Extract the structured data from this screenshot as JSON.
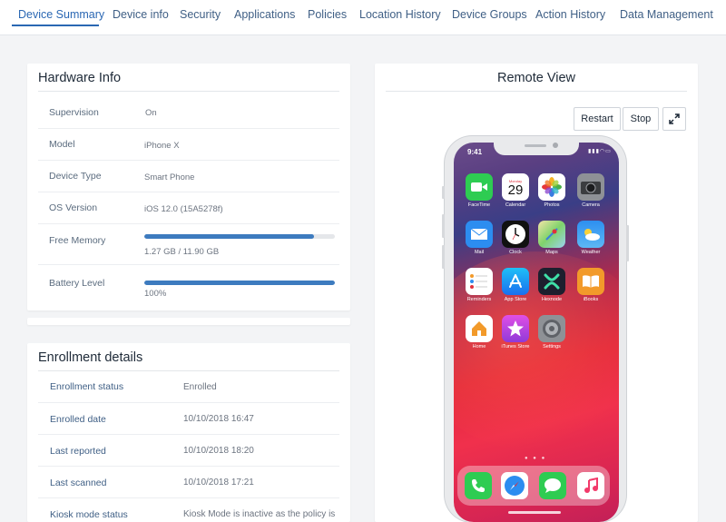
{
  "tabs": [
    {
      "label": "Device Summary",
      "active": true
    },
    {
      "label": "Device info"
    },
    {
      "label": "Security"
    },
    {
      "label": "Applications"
    },
    {
      "label": "Policies"
    },
    {
      "label": "Location History"
    },
    {
      "label": "Device Groups"
    },
    {
      "label": "Action History"
    },
    {
      "label": "Data Management"
    }
  ],
  "hardware": {
    "title": "Hardware Info",
    "rows": [
      {
        "label": "Supervision",
        "value": "On"
      },
      {
        "label": "Model",
        "value": "iPhone X"
      },
      {
        "label": "Device Type",
        "value": "Smart Phone"
      },
      {
        "label": "OS Version",
        "value": "iOS 12.0 (15A5278f)"
      },
      {
        "label": "Free Memory",
        "value": "1.27 GB / 11.90 GB",
        "progress": 0.89
      },
      {
        "label": "Battery Level",
        "value": "100%",
        "progress": 1.0
      }
    ]
  },
  "enrollment": {
    "title": "Enrollment details",
    "rows": [
      {
        "label": "Enrollment status",
        "value": "Enrolled"
      },
      {
        "label": "Enrolled date",
        "value": "10/10/2018 16:47"
      },
      {
        "label": "Last reported",
        "value": "10/10/2018 18:20"
      },
      {
        "label": "Last scanned",
        "value": "10/10/2018 17:21"
      },
      {
        "label": "Kiosk mode status",
        "value": "Kiosk Mode is inactive as the policy is"
      }
    ]
  },
  "remote": {
    "title": "Remote View",
    "restart_label": "Restart",
    "stop_label": "Stop",
    "expand_icon": "expand-icon"
  },
  "phone": {
    "time": "9:41",
    "calendar_day": "Monday",
    "calendar_date": "29",
    "apps": [
      {
        "label": "FaceTime",
        "color": "#2ecc52"
      },
      {
        "label": "Calendar",
        "color": "#ffffff"
      },
      {
        "label": "Photos",
        "color": "#ffffff"
      },
      {
        "label": "Camera",
        "color": "#8e9196"
      },
      {
        "label": "Mail",
        "color": "#2c8df0"
      },
      {
        "label": "Clock",
        "color": "#111111"
      },
      {
        "label": "Maps",
        "color": "#7fd36b"
      },
      {
        "label": "Weather",
        "color": "#3aa7f2"
      },
      {
        "label": "Reminders",
        "color": "#ffffff"
      },
      {
        "label": "App Store",
        "color": "#1a8ff0"
      },
      {
        "label": "Hexnode",
        "color": "#1d1f2e"
      },
      {
        "label": "iBooks",
        "color": "#f29a2a"
      },
      {
        "label": "Home",
        "color": "#ffffff"
      },
      {
        "label": "iTunes Store",
        "color": "#c13fd8"
      },
      {
        "label": "Settings",
        "color": "#8e9196"
      }
    ],
    "dock": [
      {
        "icon": "phone-icon",
        "color": "#2ecc52"
      },
      {
        "icon": "safari-icon",
        "color": "#ffffff"
      },
      {
        "icon": "messages-icon",
        "color": "#2ecc52"
      },
      {
        "icon": "music-icon",
        "color": "#ffffff"
      }
    ]
  }
}
